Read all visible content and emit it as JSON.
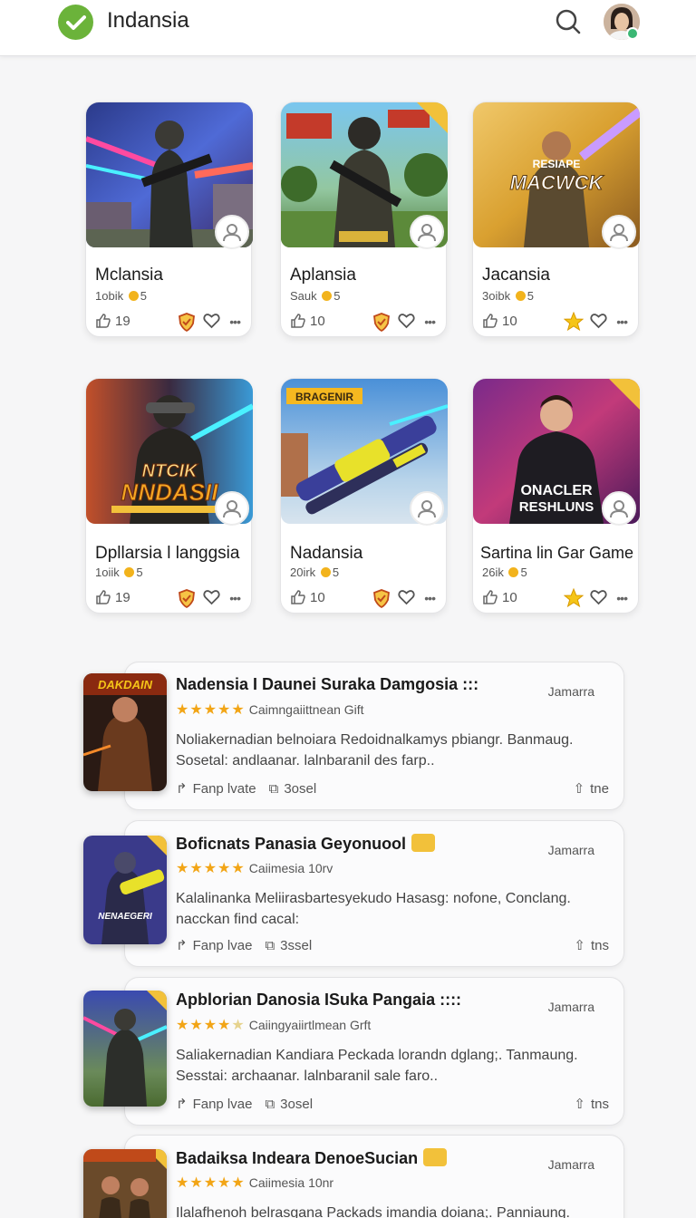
{
  "header": {
    "title": "Indansia",
    "icons": [
      "check-icon",
      "search-icon",
      "avatar"
    ],
    "brand_color": "#6bb33a"
  },
  "grid": [
    {
      "title": "Mclansia",
      "sub": "1obik",
      "sub_num": "5",
      "likes": "19",
      "badge": "shield-badge"
    },
    {
      "title": "Aplansia",
      "sub": "Sauk",
      "sub_num": "5",
      "likes": "10",
      "badge": "shield-badge"
    },
    {
      "title": "Jacansia",
      "sub": "3oibk",
      "sub_num": "5",
      "likes": "10",
      "badge": "star-badge",
      "banner": "MACWCK",
      "banner_top": "RESIAPE"
    },
    {
      "title": "Dpllarsia l langgsia",
      "sub": "1oiik",
      "sub_num": "5",
      "likes": "19",
      "badge": "shield-badge",
      "banner": "NNDASII",
      "banner_top": "NTCIK"
    },
    {
      "title": "Nadansia",
      "sub": "20irk",
      "sub_num": "5",
      "likes": "10",
      "badge": "shield-badge",
      "banner_top": "BRAGENIR"
    },
    {
      "title": "Sartina lin Gar Game",
      "sub": "26ik",
      "sub_num": "5",
      "likes": "10",
      "badge": "star-badge",
      "banner": "RESHLUNS",
      "banner_top": "ONACLER"
    }
  ],
  "list": [
    {
      "title": "Nadensia I Daunei Suraka Damgosia :::",
      "date": "Jamarra",
      "stars": 5,
      "rating_text": "Caimngaiittnean Gift",
      "desc": "Noliakernadian belnoiara Redoidnalkamys pbiangr. Banmaug. Sosetal: andlaanar. lalnbaranil des farp..",
      "foot_a": "Fanp lvate",
      "foot_b": "3osel",
      "share": "tne",
      "thumb_label": "DAKDAIN",
      "has_emoji": false
    },
    {
      "title": "Boficnats Panasia Geyonuool",
      "date": "Jamarra",
      "stars": 5,
      "rating_text": "Caiimesia 10rv",
      "desc": "Kalalinanka Meliirasbartesyekudo Hasasg: nofone, Conclang. nacckan find cacal:",
      "foot_a": "Fanp lvae",
      "foot_b": "3ssel",
      "share": "tns",
      "thumb_label": "NENAEGERI",
      "has_emoji": true
    },
    {
      "title": "Apblorian Danosia ISuka Pangaia ::::",
      "date": "Jamarra",
      "stars": 4,
      "rating_text": "Caiingyaiirtlmean Grft",
      "desc": "Saliakernadian Kandiara Peckada lorandn dglang;. Tanmaung. Sesstai: archaanar. lalnbaranil sale faro..",
      "foot_a": "Fanp lvae",
      "foot_b": "3osel",
      "share": "tns",
      "thumb_label": "",
      "has_emoji": false
    },
    {
      "title": "Badaiksa Indeara DenoeSucian",
      "date": "Jamarra",
      "stars": 5,
      "rating_text": "Caiimesia 10nr",
      "desc": "Ilalafhenoh belrasgana Packads imandia doiana;. Panniaung.",
      "foot_a": "",
      "foot_b": "",
      "share": "",
      "thumb_label": "",
      "has_emoji": true
    }
  ]
}
